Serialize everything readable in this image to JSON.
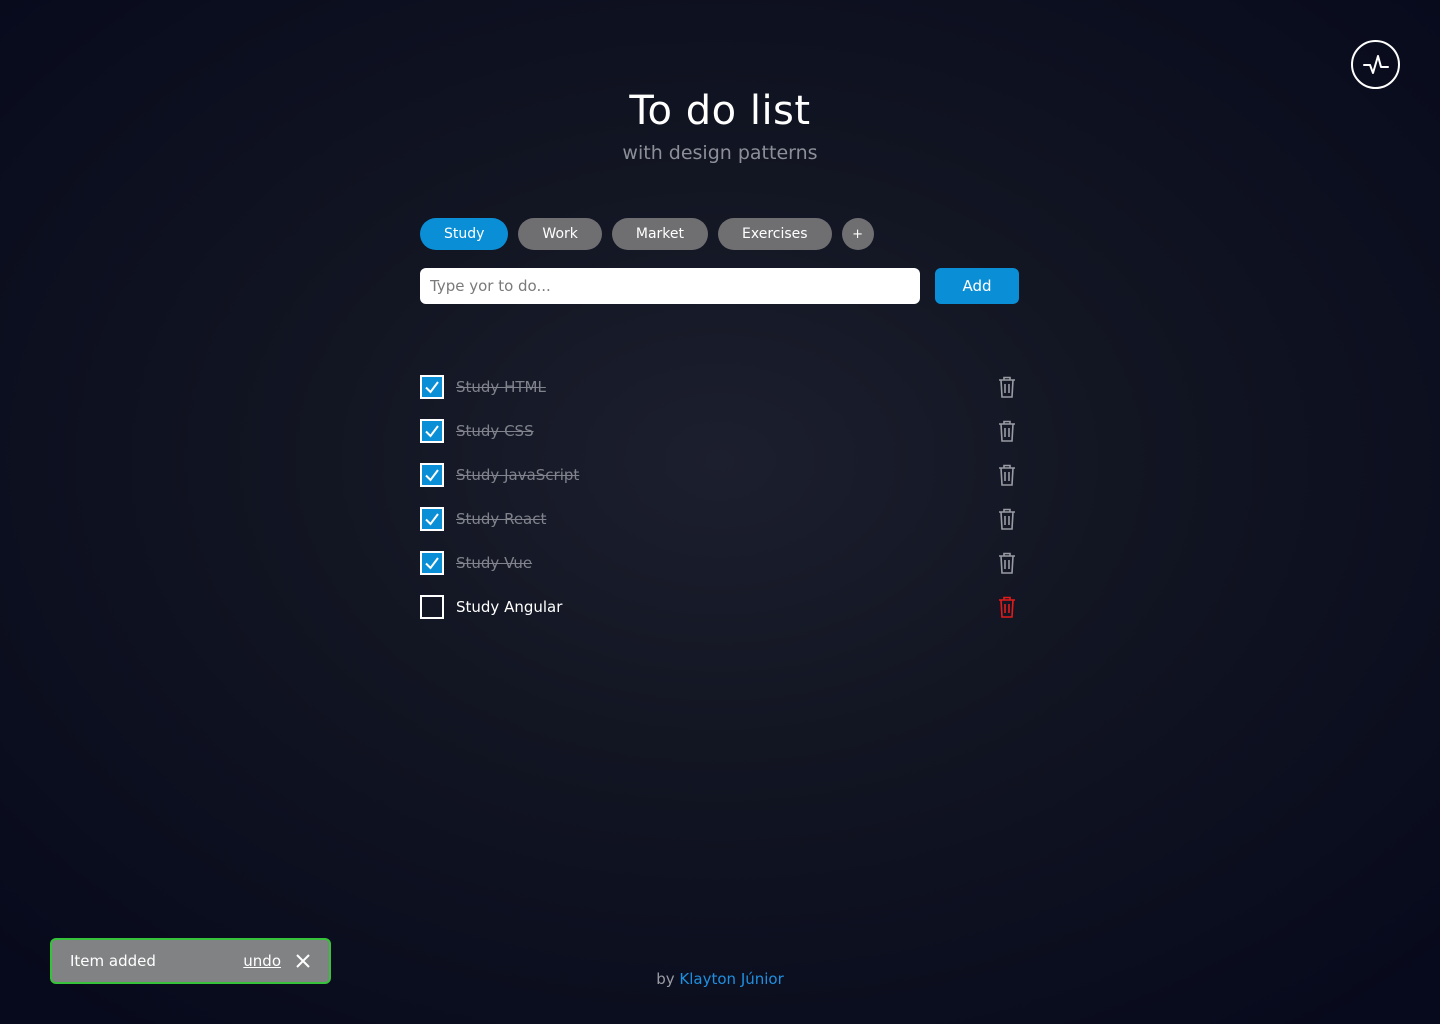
{
  "header": {
    "title": "To do list",
    "subtitle": "with design patterns"
  },
  "activity_icon": "activity-pulse-icon",
  "tabs": [
    {
      "label": "Study",
      "active": true
    },
    {
      "label": "Work",
      "active": false
    },
    {
      "label": "Market",
      "active": false
    },
    {
      "label": "Exercises",
      "active": false
    }
  ],
  "add_tab_label": "+",
  "input": {
    "value": "",
    "placeholder": "Type yor to do..."
  },
  "add_button_label": "Add",
  "items": [
    {
      "label": "Study  HTML",
      "done": true
    },
    {
      "label": "Study CSS",
      "done": true
    },
    {
      "label": "Study JavaScript",
      "done": true
    },
    {
      "label": "Study React",
      "done": true
    },
    {
      "label": "Study Vue",
      "done": true
    },
    {
      "label": "Study Angular",
      "done": false
    }
  ],
  "toast": {
    "message": "Item added",
    "undo_label": "undo"
  },
  "footer": {
    "prefix": "by",
    "author": "Klayton Júnior"
  },
  "colors": {
    "accent": "#0a8fd6",
    "tab_inactive": "#6f6f72",
    "delete_active": "#e31b1b",
    "delete_inactive": "#9a9ca4",
    "toast_border": "#36c23a"
  }
}
